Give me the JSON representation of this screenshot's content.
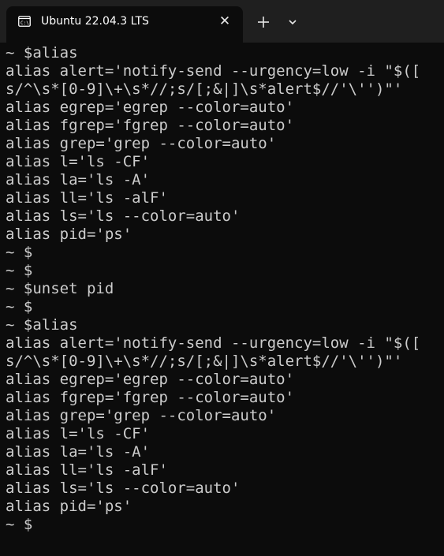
{
  "tab": {
    "title": "Ubuntu 22.04.3 LTS",
    "icon": "terminal-icon",
    "close_glyph": "✕"
  },
  "toolbar": {
    "new_tab_icon": "plus-icon",
    "dropdown_icon": "chevron-down-icon"
  },
  "colors": {
    "background": "#0c0c0c",
    "titlebar": "#1f1f1f",
    "foreground": "#cccccc"
  },
  "terminal": {
    "lines": [
      "~ $alias",
      "alias alert='notify-send --urgency=low -i \"$([",
      "s/^\\s*[0-9]\\+\\s*//;s/[;&|]\\s*alert$//'\\'')\"'",
      "alias egrep='egrep --color=auto'",
      "alias fgrep='fgrep --color=auto'",
      "alias grep='grep --color=auto'",
      "alias l='ls -CF'",
      "alias la='ls -A'",
      "alias ll='ls -alF'",
      "alias ls='ls --color=auto'",
      "alias pid='ps'",
      "~ $",
      "~ $",
      "~ $unset pid",
      "~ $",
      "~ $alias",
      "alias alert='notify-send --urgency=low -i \"$([",
      "s/^\\s*[0-9]\\+\\s*//;s/[;&|]\\s*alert$//'\\'')\"'",
      "alias egrep='egrep --color=auto'",
      "alias fgrep='fgrep --color=auto'",
      "alias grep='grep --color=auto'",
      "alias l='ls -CF'",
      "alias la='ls -A'",
      "alias ll='ls -alF'",
      "alias ls='ls --color=auto'",
      "alias pid='ps'",
      "~ $"
    ]
  }
}
